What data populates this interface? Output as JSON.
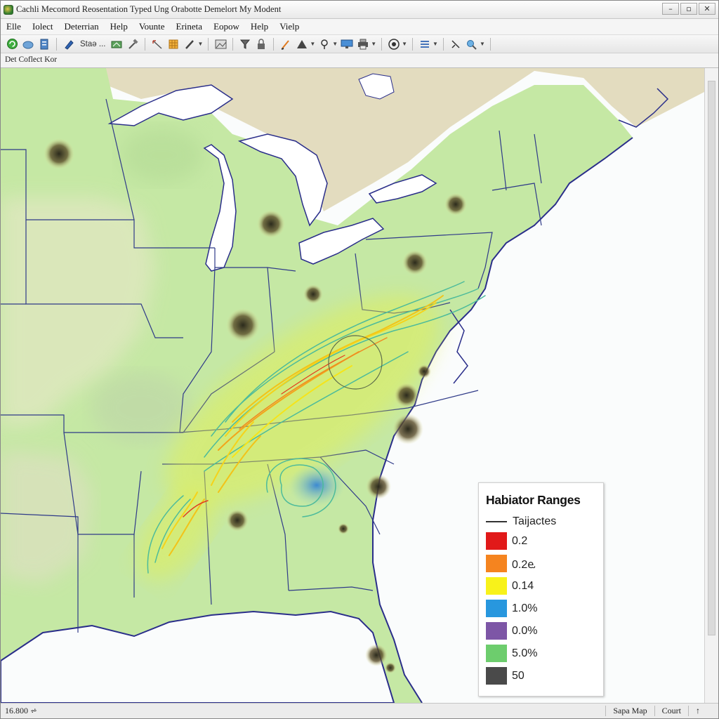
{
  "window": {
    "title": "Cachli Mecomord Reosentation Typed Ung Orabotte Demelort My Modent"
  },
  "menu": [
    "Elle",
    "Iolect",
    "Deterrian",
    "Help",
    "Vounte",
    "Erineta",
    "Eopow",
    "Help",
    "Vielp"
  ],
  "toolbar": {
    "stage_label": "Staǝ ..."
  },
  "subbar": {
    "label": "Det Coflect Kor"
  },
  "map": {
    "icons": [
      "event-icon"
    ]
  },
  "legend": {
    "title": "Habiator Ranges",
    "line_label": "Taijactes",
    "entries": [
      {
        "label": "0.2",
        "color": "#e11919"
      },
      {
        "label": "0.2ⱸ",
        "color": "#f5841f"
      },
      {
        "label": "0.14",
        "color": "#f8f21a"
      },
      {
        "label": "1.0%",
        "color": "#2897de"
      },
      {
        "label": "0.0%",
        "color": "#7d56a6"
      },
      {
        "label": "5.0%",
        "color": "#6dcd6d"
      },
      {
        "label": "50",
        "color": "#4a4a4a"
      }
    ]
  },
  "statusbar": {
    "left": "16.800 ⩫",
    "items": [
      "Sapa Map",
      "Court",
      "↑"
    ]
  }
}
